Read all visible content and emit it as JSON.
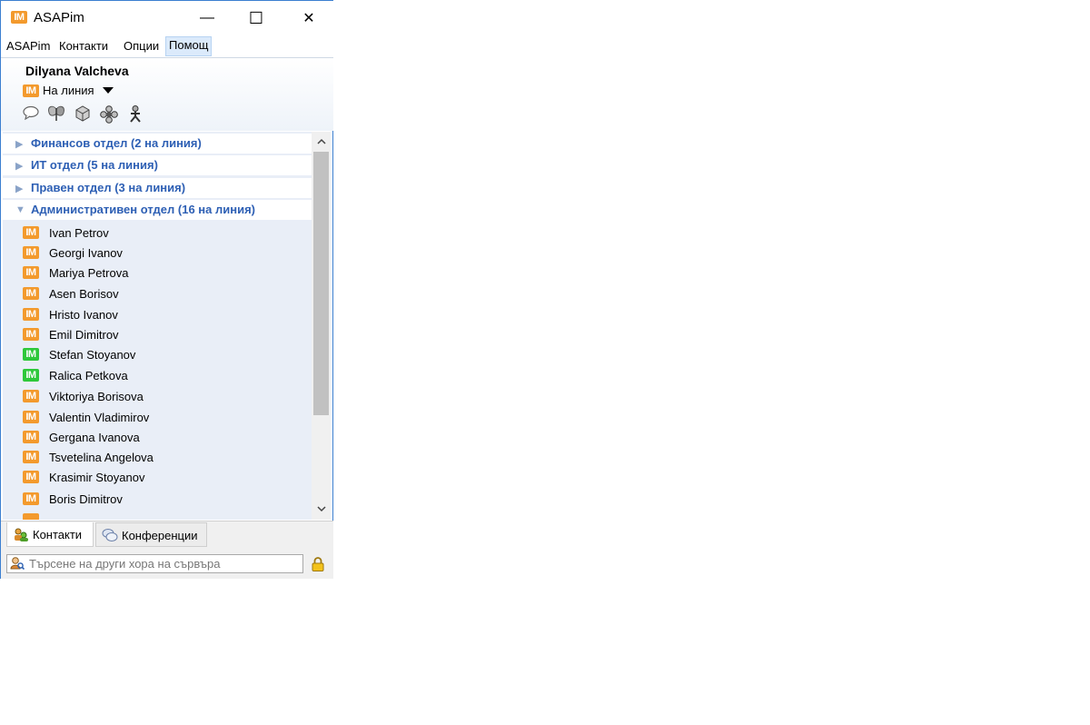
{
  "window": {
    "app_logo": "IM",
    "title": "ASAPim",
    "minimize_glyph": "—",
    "maximize_glyph": "☐",
    "close_glyph": "✕"
  },
  "menu": [
    {
      "label": "ASAPim",
      "active": false
    },
    {
      "label": "Контакти",
      "active": false
    },
    {
      "label": "Опции",
      "active": false
    },
    {
      "label": "Помощ",
      "active": true
    }
  ],
  "profile": {
    "name": "Dilyana Valcheva",
    "status": "На линия",
    "status_icon": "IM"
  },
  "toolbar_icons": [
    "chat-bubble-icon",
    "butterfly-icon",
    "package-icon",
    "flower-icon",
    "person-icon"
  ],
  "groups": [
    {
      "label": "Финансов отдел (2 на линия)",
      "expanded": false
    },
    {
      "label": "ИТ отдел (5 на линия)",
      "expanded": false
    },
    {
      "label": "Правен отдел (3 на линия)",
      "expanded": false
    },
    {
      "label": "Административен отдел (16 на линия)",
      "expanded": true
    }
  ],
  "contacts": [
    {
      "name": "Ivan Petrov",
      "icon": "IM",
      "status_color": "#f39a2d"
    },
    {
      "name": "Georgi Ivanov",
      "icon": "IM",
      "status_color": "#f39a2d"
    },
    {
      "name": "Mariya Petrova",
      "icon": "IM",
      "status_color": "#f39a2d"
    },
    {
      "name": "Asen Borisov",
      "icon": "IM",
      "status_color": "#f39a2d"
    },
    {
      "name": "Hristo Ivanov",
      "icon": "IM",
      "status_color": "#f39a2d"
    },
    {
      "name": "Emil Dimitrov",
      "icon": "IM",
      "status_color": "#f39a2d"
    },
    {
      "name": "Stefan Stoyanov",
      "icon": "IM",
      "status_color": "#2ec83a"
    },
    {
      "name": "Ralica Petkova",
      "icon": "IM",
      "status_color": "#2ec83a"
    },
    {
      "name": "Viktoriya Borisova",
      "icon": "IM",
      "status_color": "#f39a2d"
    },
    {
      "name": "Valentin Vladimirov",
      "icon": "IM",
      "status_color": "#f39a2d"
    },
    {
      "name": "Gergana Ivanova",
      "icon": "IM",
      "status_color": "#f39a2d"
    },
    {
      "name": "Tsvetelina Angelova",
      "icon": "IM",
      "status_color": "#f39a2d"
    },
    {
      "name": "Krasimir Stoyanov",
      "icon": "IM",
      "status_color": "#f39a2d"
    },
    {
      "name": "Boris Dimitrov",
      "icon": "IM",
      "status_color": "#f39a2d"
    }
  ],
  "tabs": [
    {
      "label": "Контакти",
      "icon": "contacts-icon",
      "selected": true
    },
    {
      "label": "Конференции",
      "icon": "conference-icon",
      "selected": false
    }
  ],
  "search": {
    "placeholder": "Търсене на други хора на сървъра"
  },
  "colors": {
    "window_border": "#3c7fd0",
    "group_text": "#2d5fb4",
    "list_background": "#e9eef7",
    "away_icon": "#f39a2d",
    "online_icon": "#2ec83a"
  }
}
